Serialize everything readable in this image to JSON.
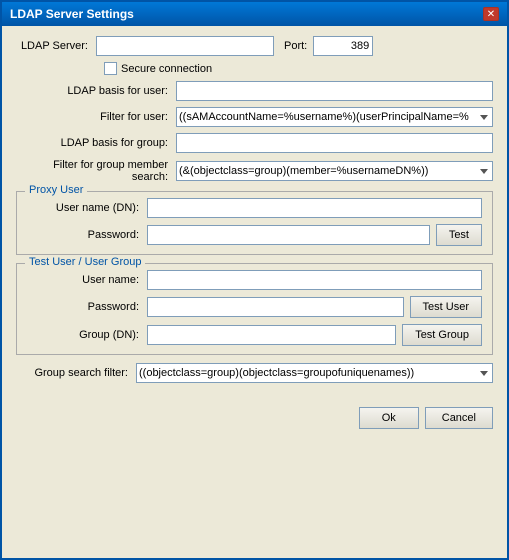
{
  "window": {
    "title": "LDAP Server Settings",
    "close_label": "✕"
  },
  "form": {
    "ldap_server_label": "LDAP Server:",
    "ldap_server_value": "",
    "port_label": "Port:",
    "port_value": "389",
    "secure_label": "Secure connection",
    "ldap_basis_user_label": "LDAP basis for user:",
    "ldap_basis_user_value": "",
    "filter_user_label": "Filter for user:",
    "filter_user_value": "((sAMAccountName=%username%)(userPrincipalName=%",
    "ldap_basis_group_label": "LDAP basis for group:",
    "ldap_basis_group_value": "",
    "filter_group_label": "Filter for group member search:",
    "filter_group_value": "(&(objectclass=group)(member=%usernameDN%))"
  },
  "proxy_user": {
    "section_title": "Proxy User",
    "username_label": "User name (DN):",
    "username_value": "",
    "password_label": "Password:",
    "password_value": "",
    "test_btn": "Test"
  },
  "test_user_group": {
    "section_title": "Test User / User Group",
    "username_label": "User name:",
    "username_value": "",
    "password_label": "Password:",
    "password_value": "",
    "test_user_btn": "Test User",
    "group_label": "Group (DN):",
    "group_value": "",
    "test_group_btn": "Test Group"
  },
  "group_search": {
    "label": "Group search filter:",
    "value": "((objectclass=group)(objectclass=groupofuniquenames))"
  },
  "dialog_buttons": {
    "ok_label": "Ok",
    "cancel_label": "Cancel"
  }
}
